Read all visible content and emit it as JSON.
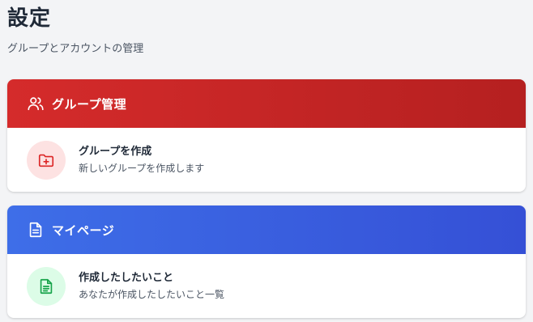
{
  "page": {
    "title": "設定",
    "subtitle": "グループとアカウントの管理"
  },
  "groups_card": {
    "header_icon": "users-icon",
    "header_title": "グループ管理",
    "header_color": "#d52b2b",
    "items": [
      {
        "icon": "folder-plus-icon",
        "title": "グループを作成",
        "description": "新しいグループを作成します"
      }
    ]
  },
  "mypage_card": {
    "header_icon": "document-icon",
    "header_title": "マイページ",
    "header_color": "#3e6ee8",
    "items": [
      {
        "icon": "document-text-icon",
        "title": "作成したしたいこと",
        "description": "あなたが作成したしたいこと一覧"
      }
    ]
  }
}
